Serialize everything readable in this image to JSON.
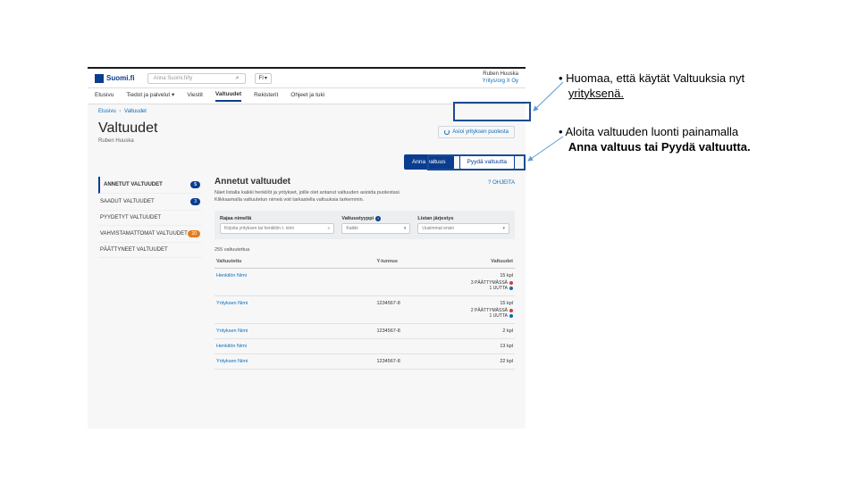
{
  "annotations": {
    "a1_line1": "Huomaa, että käytät Valtuuksia nyt",
    "a1_line2": "yrityksenä.",
    "a2_line1": "Aloita valtuuden luonti painamalla",
    "a2_line2": "Anna valtuus tai Pyydä valtuutta."
  },
  "logo": "Suomi.fi",
  "search_placeholder": "Anna Suomi.fi/ty",
  "lang": "FI",
  "user_name": "Ruben Huuska",
  "user_org": "Yritys/org X Oy",
  "nav": {
    "etusivu": "Etusivu",
    "tiedot": "Tiedot ja palvelut",
    "viestit": "Viestit",
    "valtuudet": "Valtuudet",
    "rekisterit": "Rekisterit",
    "ohjeet": "Ohjeet ja tuki"
  },
  "crumb_home": "Etusivu",
  "crumb_current": "Valtuudet",
  "page_title": "Valtuudet",
  "page_sub": "Ruben Huuska",
  "company_switch": "Asioi yrityksen puolesta",
  "btn_primary": "Anna valtuus",
  "btn_secondary": "Pyydä valtuutta",
  "sidebar": {
    "s1": "ANNETUT VALTUUDET",
    "b1": "5",
    "s2": "SAADUT VALTUUDET",
    "b2": "3",
    "s3": "PYYDETYT VALTUUDET",
    "s4": "VAHVISTAMATTOMAT VALTUUDET",
    "b4": "20",
    "s5": "PÄÄTTYNEET VALTUUDET"
  },
  "content_title": "Annetut valtuudet",
  "help": "OHJEITA",
  "desc1": "Näet listalla kaikki henkilöt ja yritykset, joille olet antanut valtuuden asioida puolestasi.",
  "desc2": "Klikkaamalla valtuutetun nimeä voit tarkastella valtuuksia tarkemmin.",
  "filters": {
    "f1_label": "Rajaa nimellä",
    "f1_ph": "Kirjoita yrityksen tai henkilön t. nimi",
    "f2_label": "Valtuustyyppi",
    "f2_val": "Kaikki",
    "f3_label": "Listan järjestys",
    "f3_val": "Uusimmat ensin"
  },
  "count": "255 valtuutettua",
  "th1": "Valtuutettu",
  "th2": "Y-tunnus",
  "th3": "Valtuudet",
  "rows": [
    {
      "name": "Henkilön Nimi",
      "yt": "",
      "cnt": "15 kpl",
      "extras": [
        {
          "t": "3 PÄÄTTYMÄSSÄ",
          "c": "red"
        },
        {
          "t": "1 UUTTA",
          "c": "blue"
        }
      ]
    },
    {
      "name": "Yrityksen Nimi",
      "yt": "1234567-8",
      "cnt": "15 kpl",
      "extras": [
        {
          "t": "2 PÄÄTTYMÄSSÄ",
          "c": "red"
        },
        {
          "t": "1 UUTTA",
          "c": "blue"
        }
      ]
    },
    {
      "name": "Yrityksen Nimi",
      "yt": "1234567-8",
      "cnt": "2 kpl",
      "extras": []
    },
    {
      "name": "Henkilön Nimi",
      "yt": "",
      "cnt": "13 kpl",
      "extras": []
    },
    {
      "name": "Yrityksen Nimi",
      "yt": "1234567-8",
      "cnt": "22 kpl",
      "extras": []
    }
  ]
}
